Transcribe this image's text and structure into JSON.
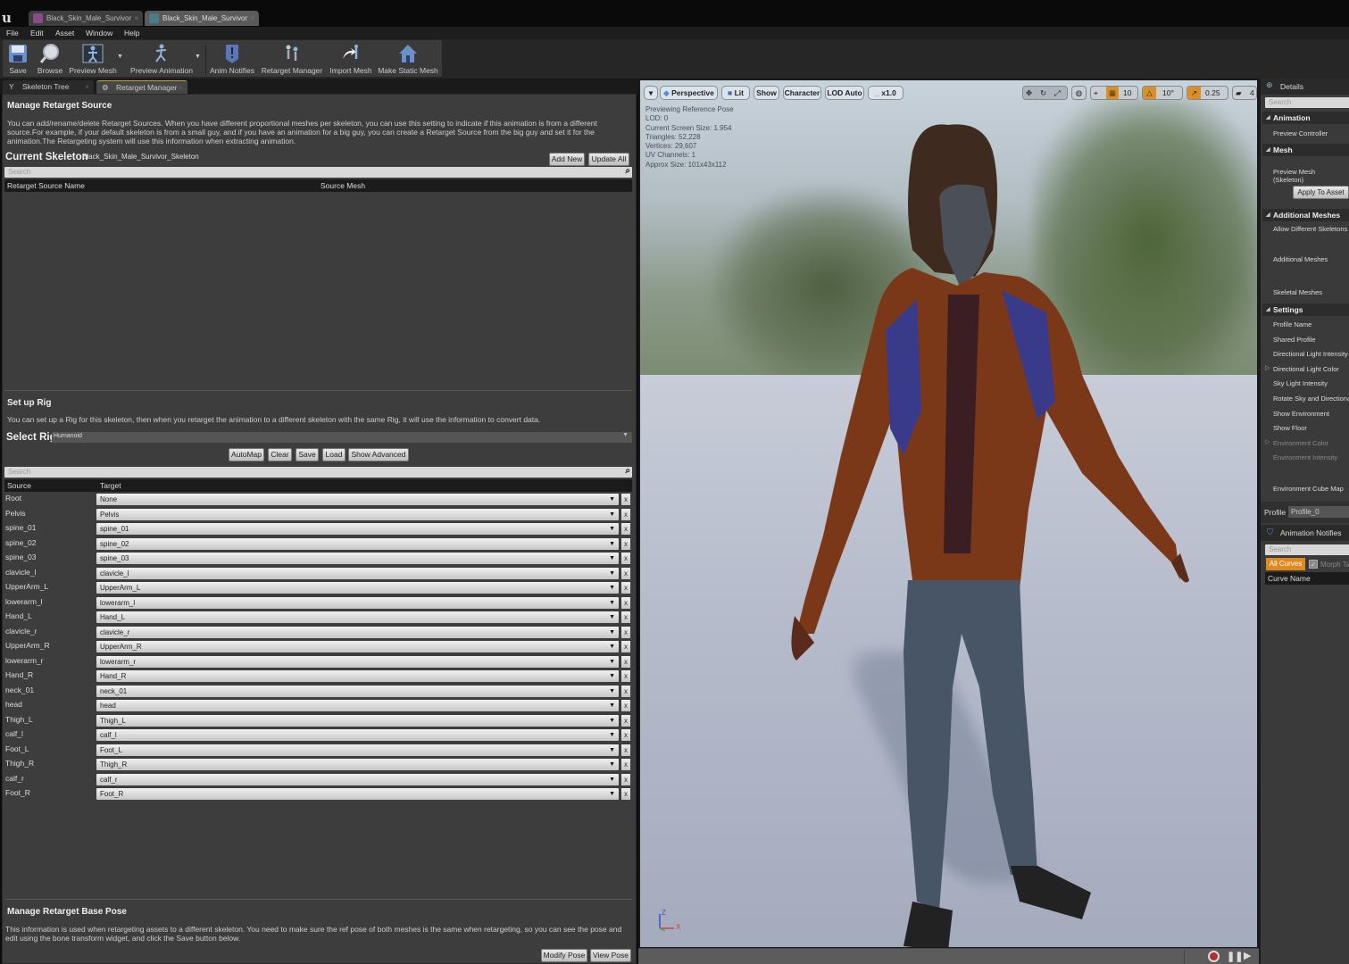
{
  "window": {
    "doc_tabs": [
      {
        "label": "Black_Skin_Male_Survivor",
        "icon": "skeletal-mesh-icon",
        "color": "#8a4b8a"
      },
      {
        "label": "Black_Skin_Male_Survivor",
        "icon": "skeleton-icon",
        "color": "#4b7a8a"
      }
    ]
  },
  "menu": [
    "File",
    "Edit",
    "Asset",
    "Window",
    "Help"
  ],
  "toolbar": {
    "buttons": [
      {
        "label": "Save",
        "icon": "save-icon"
      },
      {
        "label": "Browse",
        "icon": "browse-icon"
      },
      {
        "label": "Preview Mesh",
        "icon": "preview-mesh-icon"
      },
      {
        "label": "Preview Animation",
        "icon": "preview-animation-icon"
      },
      {
        "label": "Anim Notifies",
        "icon": "anim-notifies-icon"
      },
      {
        "label": "Retarget Manager",
        "icon": "retarget-manager-icon"
      },
      {
        "label": "Import Mesh",
        "icon": "import-mesh-icon"
      },
      {
        "label": "Make Static Mesh",
        "icon": "make-static-mesh-icon"
      }
    ]
  },
  "left_tabs": [
    {
      "label": "Skeleton Tree",
      "active": false
    },
    {
      "label": "Retarget Manager",
      "active": true
    }
  ],
  "retarget_source": {
    "title": "Manage Retarget Source",
    "description": "You can add/rename/delete Retarget Sources. When you have different proportional meshes per skeleton, you can use this setting to indicate if this animation is from a different source.For example, if your default skeleton is from a small guy, and if you have an animation for a big guy, you can create a Retarget Source from the big guy and set it for the animation.The Retargeting system will use this information when extracting animation.",
    "current_skeleton_label": "Current Skeleton",
    "current_skeleton_value": "Black_Skin_Male_Survivor_Skeleton",
    "add_new": "Add New",
    "update_all": "Update All",
    "search_placeholder": "Search",
    "columns": [
      "Retarget Source Name",
      "Source Mesh"
    ]
  },
  "rig": {
    "title": "Set up Rig",
    "description": "You can set up a Rig for this skeleton, then when you retarget the animation to a different skeleton with the same Rig, it will use the information to convert data.",
    "select_label": "Select Rig",
    "selected": "Humanoid",
    "buttons": [
      "AutoMap",
      "Clear",
      "Save",
      "Load",
      "Show Advanced"
    ],
    "search_placeholder": "Search",
    "columns": [
      "Source",
      "Target"
    ],
    "rows": [
      {
        "source": "Root",
        "target": "None"
      },
      {
        "source": "Pelvis",
        "target": "Pelvis"
      },
      {
        "source": "spine_01",
        "target": "spine_01"
      },
      {
        "source": "spine_02",
        "target": "spine_02"
      },
      {
        "source": "spine_03",
        "target": "spine_03"
      },
      {
        "source": "clavicle_l",
        "target": "clavicle_l"
      },
      {
        "source": "UpperArm_L",
        "target": "UpperArm_L"
      },
      {
        "source": "lowerarm_l",
        "target": "lowerarm_l"
      },
      {
        "source": "Hand_L",
        "target": "Hand_L"
      },
      {
        "source": "clavicle_r",
        "target": "clavicle_r"
      },
      {
        "source": "UpperArm_R",
        "target": "UpperArm_R"
      },
      {
        "source": "lowerarm_r",
        "target": "lowerarm_r"
      },
      {
        "source": "Hand_R",
        "target": "Hand_R"
      },
      {
        "source": "neck_01",
        "target": "neck_01"
      },
      {
        "source": "head",
        "target": "head"
      },
      {
        "source": "Thigh_L",
        "target": "Thigh_L"
      },
      {
        "source": "calf_l",
        "target": "calf_l"
      },
      {
        "source": "Foot_L",
        "target": "Foot_L"
      },
      {
        "source": "Thigh_R",
        "target": "Thigh_R"
      },
      {
        "source": "calf_r",
        "target": "calf_r"
      },
      {
        "source": "Foot_R",
        "target": "Foot_R"
      }
    ],
    "clear_glyph": "x"
  },
  "base_pose": {
    "title": "Manage Retarget Base Pose",
    "description": "This information is used when retargeting assets to a different skeleton. You need to make sure the ref pose of both meshes is the same when retargeting, so you can see the pose and edit using the bone transform widget, and click the Save button below.",
    "modify": "Modify Pose",
    "view": "View Pose"
  },
  "viewport": {
    "toolbar": [
      "Perspective",
      "Lit",
      "Show",
      "Character",
      "LOD Auto",
      "x1.0"
    ],
    "info": [
      "Previewing Reference Pose",
      "LOD: 0",
      "Current Screen Size: 1.954",
      "Triangles: 52,228",
      "Vertices: 29,607",
      "UV Channels: 1",
      "Approx Size: 101x43x112"
    ],
    "grid_snap": "10",
    "rotation_snap": "10°",
    "scale_snap": "0.25",
    "camera_speed": "4",
    "axis_labels": {
      "z": "Z",
      "x": "X"
    },
    "accent": "#d9902a"
  },
  "details": {
    "tab": "Details",
    "search_placeholder": "Search",
    "categories": {
      "animation": "Animation",
      "mesh": "Mesh",
      "additional": "Additional Meshes",
      "settings": "Settings"
    },
    "props": {
      "preview_controller": "Preview Controller",
      "preview_mesh": "Preview Mesh (Skeleton)",
      "apply_to_asset": "Apply To Asset",
      "allow_different": "Allow Different Skeletons",
      "additional_meshes": "Additional Meshes",
      "skeletal_meshes": "Skeletal Meshes",
      "profile_name": "Profile Name",
      "shared_profile": "Shared Profile",
      "dir_light_intensity": "Directional Light Intensity",
      "dir_light_color": "Directional Light Color",
      "sky_light_intensity": "Sky Light Intensity",
      "rotate_sky": "Rotate Sky and Directional Light",
      "show_environment": "Show Environment",
      "show_floor": "Show Floor",
      "env_color": "Environment Color",
      "env_intensity": "Environment Intensity",
      "env_cube_map": "Environment Cube Map"
    },
    "profile_label": "Profile",
    "profile_value": "Profile_0"
  },
  "anim_notifies": {
    "tab": "Animation Notifies",
    "search_placeholder": "Search",
    "all_curves": "All Curves",
    "morph": "Morph Target",
    "curve_name": "Curve Name"
  }
}
